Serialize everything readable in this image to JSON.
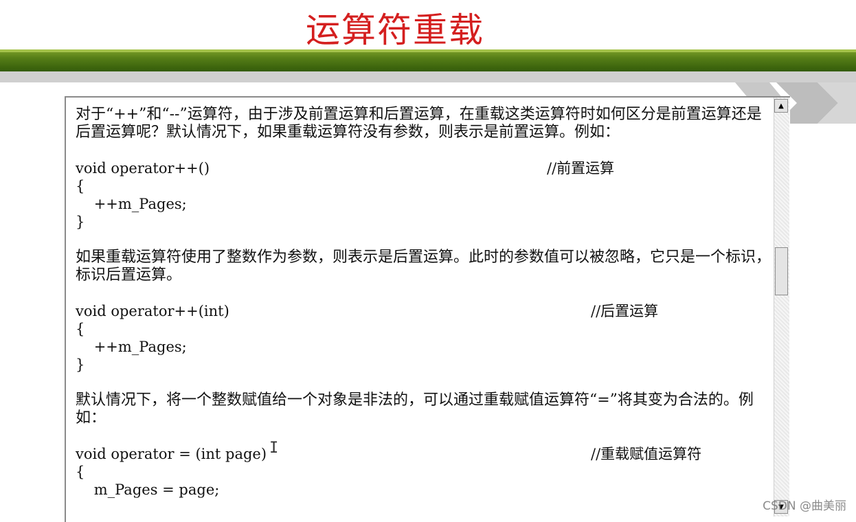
{
  "slide": {
    "title": "运算符重载",
    "paragraphs": [
      "对于“++”和“--”运算符，由于涉及前置运算和后置运算，在重载这类运算符时如何区分是前置运算还是后置运算呢？默认情况下，如果重载运算符没有参数，则表示是前置运算。例如：",
      "如果重载运算符使用了整数作为参数，则表示是后置运算。此时的参数值可以被忽略，它只是一个标识，标识后置运算。",
      "默认情况下，将一个整数赋值给一个对象是非法的，可以通过重载赋值运算符“=”将其变为合法的。例如："
    ],
    "code_blocks": [
      {
        "signature": "void operator++()",
        "comment": "//前置运算",
        "open": "{",
        "body": "    ++m_Pages;",
        "close": "}"
      },
      {
        "signature": "void operator++(int)",
        "comment": "//后置运算",
        "open": "{",
        "body": "    ++m_Pages;",
        "close": "}"
      },
      {
        "signature": "void operator = (int page)",
        "comment": "//重载赋值运算符",
        "open": "{",
        "body": "    m_Pages = page;"
      }
    ]
  },
  "scrollbar": {
    "up_glyph": "▲",
    "down_glyph": "▼"
  },
  "cursor_glyph": "I",
  "watermark": "CSDN @曲美丽"
}
